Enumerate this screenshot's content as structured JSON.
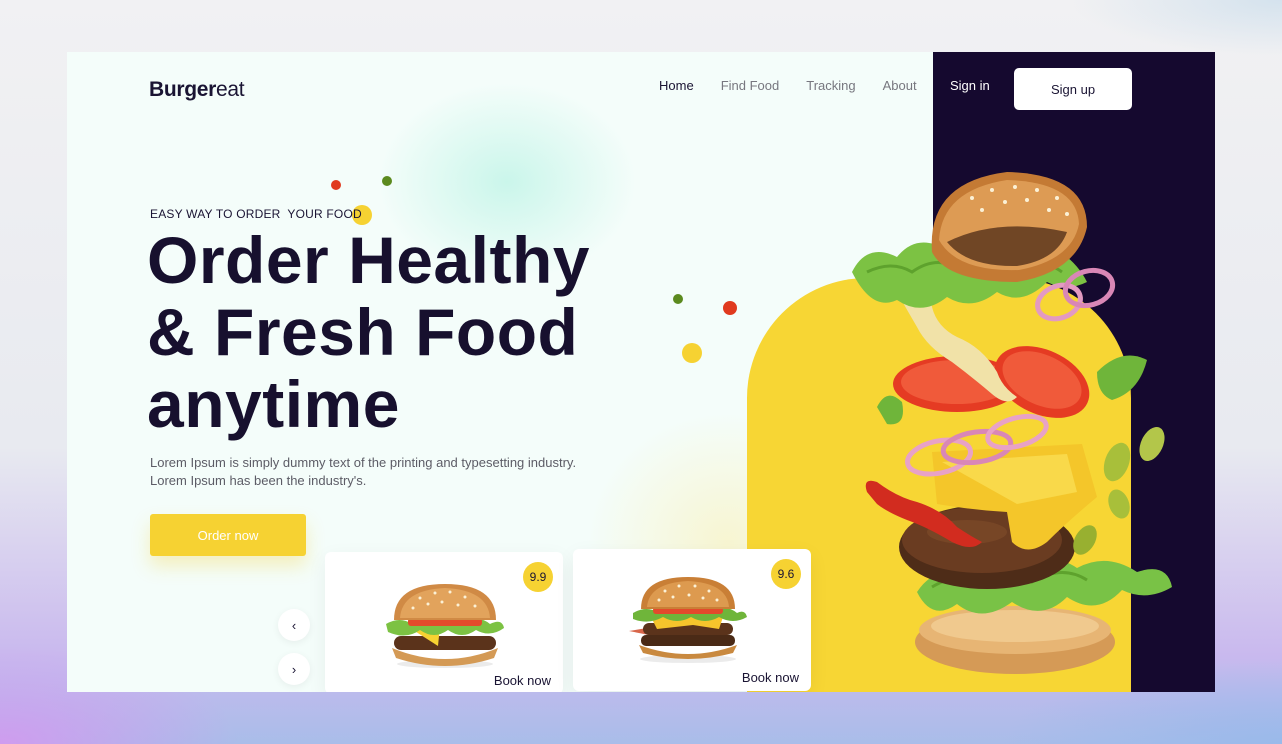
{
  "brand": {
    "name_bold": "Burger",
    "name_light": "eat"
  },
  "nav": {
    "items": [
      {
        "label": "Home",
        "active": true
      },
      {
        "label": "Find Food",
        "active": false
      },
      {
        "label": "Tracking",
        "active": false
      },
      {
        "label": "About",
        "active": false
      }
    ],
    "signin": "Sign in",
    "signup": "Sign up"
  },
  "hero": {
    "tagline": "EASY WAY TO ORDER  YOUR FOOD",
    "headline": [
      "Order Healthy",
      "& Fresh Food",
      "anytime"
    ],
    "subtext": [
      "Lorem Ipsum is simply dummy text of the printing and typesetting industry.",
      "Lorem Ipsum has been the industry's."
    ],
    "cta": "Order now"
  },
  "carousel": {
    "prev_icon": "‹",
    "next_icon": "›",
    "cards": [
      {
        "rating": "9.9",
        "action": "Book now"
      },
      {
        "rating": "9.6",
        "action": "Book now"
      }
    ]
  },
  "colors": {
    "accent": "#f6d232",
    "dark": "#15092f",
    "text": "#1a1433",
    "background": "#f4fdfa",
    "dot_red": "#e03a1e",
    "dot_green": "#5b8a1e"
  }
}
